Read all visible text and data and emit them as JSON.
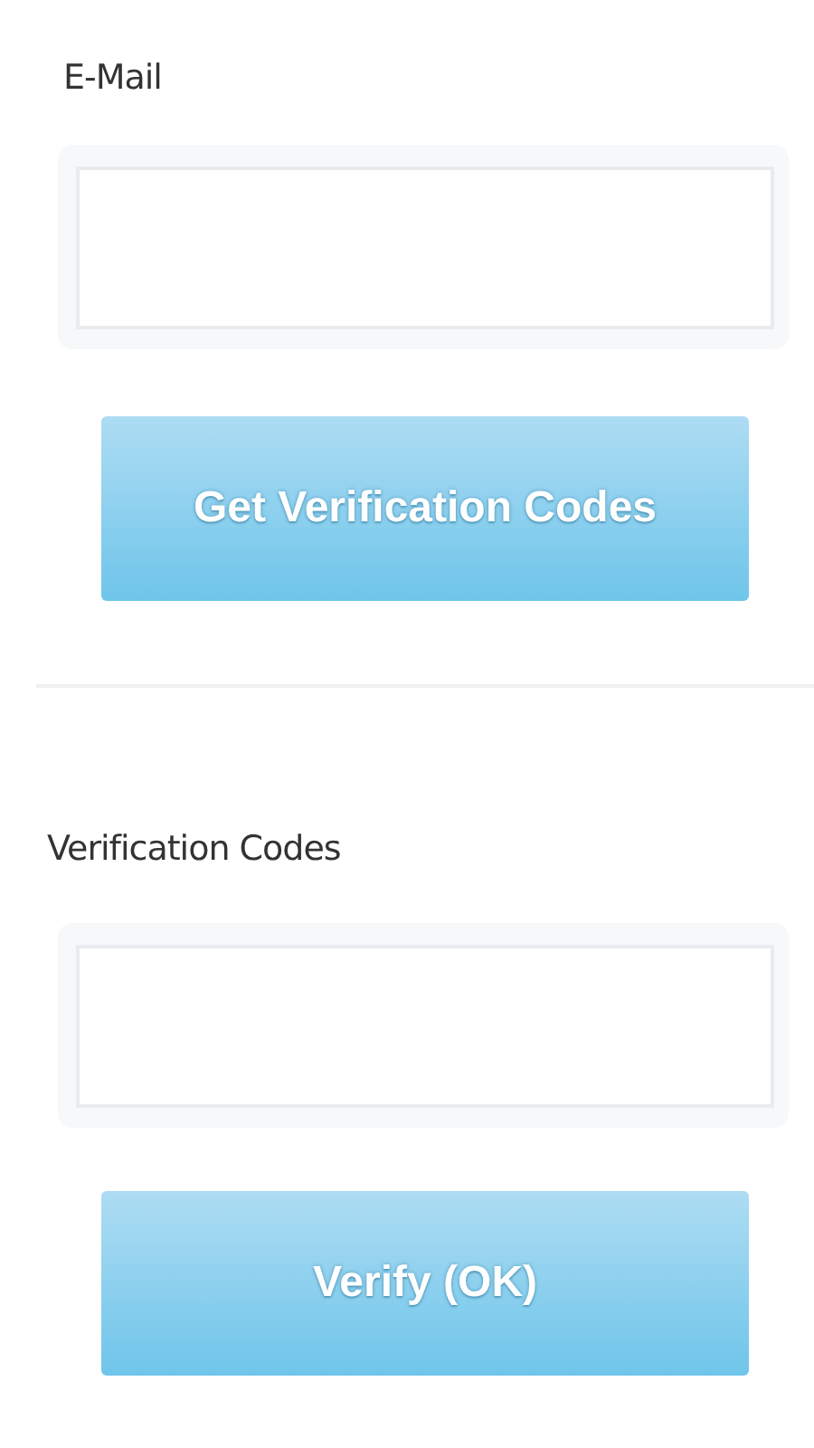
{
  "email": {
    "label": "E-Mail"
  },
  "get_codes_button": {
    "label": "Get Verification Codes"
  },
  "codes": {
    "label": "Verification Codes"
  },
  "verify_button": {
    "label": "Verify (OK)"
  }
}
